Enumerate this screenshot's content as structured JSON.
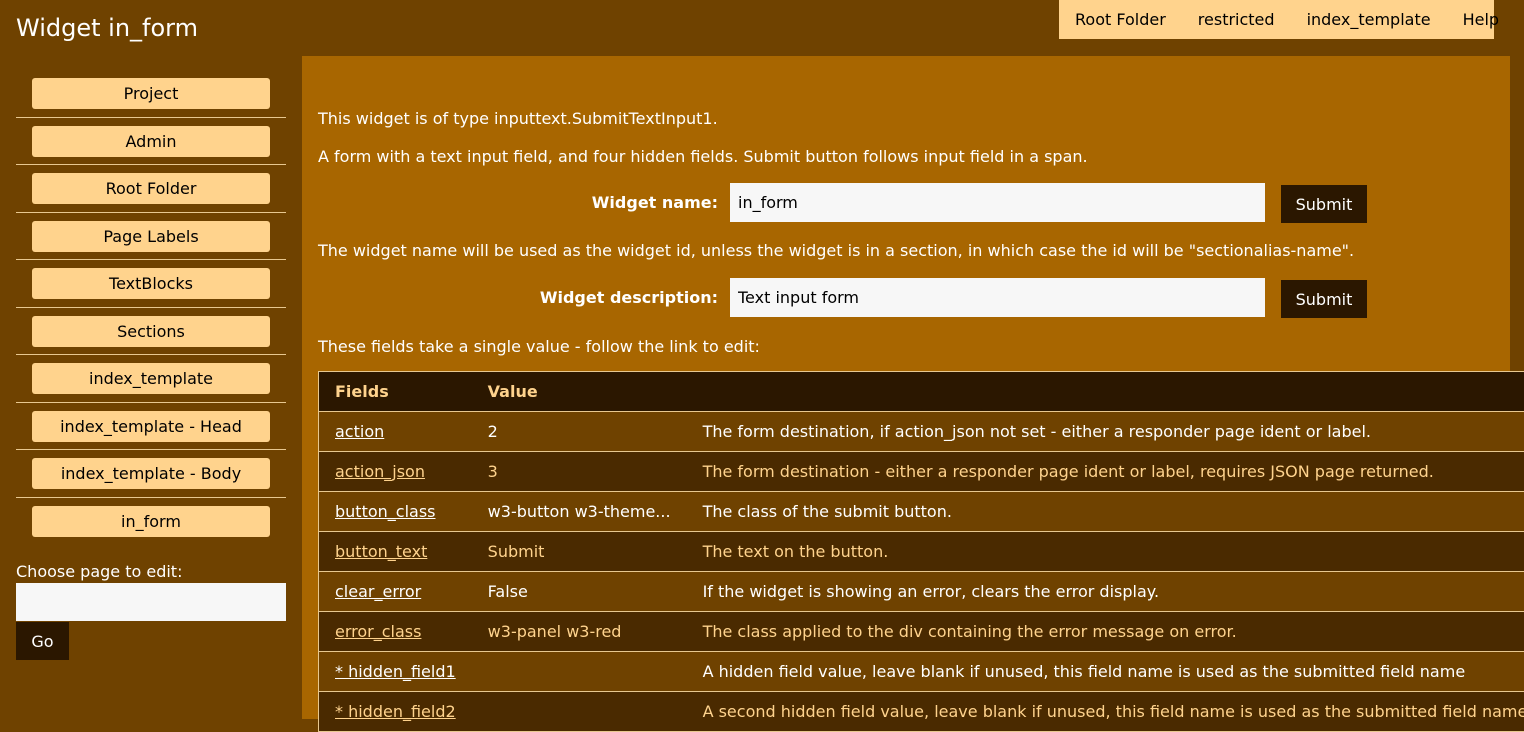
{
  "header": {
    "title": "Widget in_form"
  },
  "topnav": [
    "Root Folder",
    "restricted",
    "index_template",
    "Help"
  ],
  "sidebar": {
    "items": [
      "Project",
      "Admin",
      "Root Folder",
      "Page Labels",
      "TextBlocks",
      "Sections",
      "index_template",
      "index_template - Head",
      "index_template - Body",
      "in_form"
    ],
    "choose_label": "Choose page to edit:",
    "choose_value": "",
    "go_label": "Go"
  },
  "main": {
    "type_text": "This widget is of type inputtext.SubmitTextInput1.",
    "desc_text": "A form with a text input field, and four hidden fields. Submit button follows input field in a span.",
    "name_label": "Widget name:",
    "name_value": "in_form",
    "name_submit": "Submit",
    "name_note": "The widget name will be used as the widget id, unless the widget is in a section, in which case the id will be \"sectionalias-name\".",
    "desc_label": "Widget description:",
    "desc_value": "Text input form",
    "desc_submit": "Submit",
    "fields_intro": "These fields take a single value - follow the link to edit:"
  },
  "table": {
    "headers": [
      "Fields",
      "Value",
      ""
    ],
    "rows": [
      [
        "action",
        "2",
        "The form destination, if action_json not set - either a responder page ident or label."
      ],
      [
        "action_json",
        "3",
        "The form destination - either a responder page ident or label, requires JSON page returned."
      ],
      [
        "button_class",
        "w3-button w3-theme...",
        "The class of the submit button."
      ],
      [
        "button_text",
        "Submit",
        "The text on the button."
      ],
      [
        "clear_error",
        "False",
        "If the widget is showing an error, clears the error display."
      ],
      [
        "error_class",
        "w3-panel w3-red",
        "The class applied to the div containing the error message on error."
      ],
      [
        "* hidden_field1",
        "",
        "A hidden field value, leave blank if unused, this field name is used as the submitted field name"
      ],
      [
        "* hidden_field2",
        "",
        "A second hidden field value, leave blank if unused, this field name is used as the submitted field name"
      ]
    ]
  },
  "colors": {
    "background": "#6f4200",
    "main": "#a86600",
    "button_light": "#ffd38d",
    "button_dark": "#2b1700"
  }
}
